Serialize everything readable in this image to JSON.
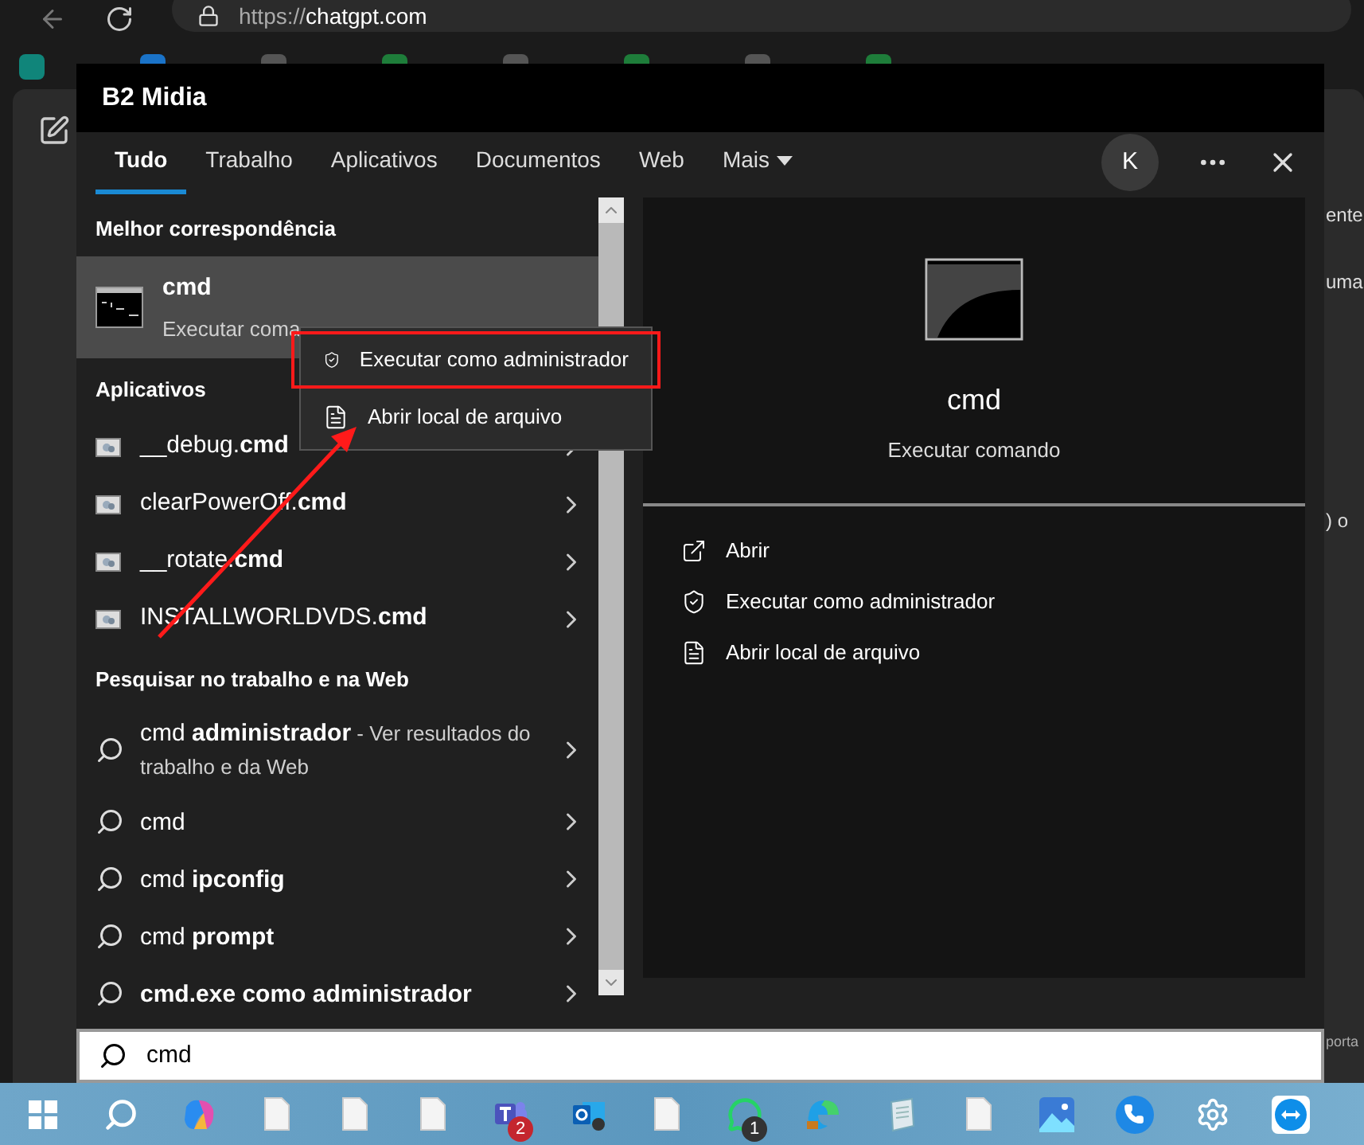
{
  "browser": {
    "url_scheme": "https://",
    "url_host": "chatgpt.com"
  },
  "background_fragments": [
    "ente",
    "uma",
    ") o",
    "porta"
  ],
  "window": {
    "title": "B2 Midia"
  },
  "tabs": [
    {
      "label": "Tudo",
      "selected": true,
      "kind": "tab"
    },
    {
      "label": "Trabalho",
      "selected": false,
      "kind": "tab"
    },
    {
      "label": "Aplicativos",
      "selected": false,
      "kind": "tab"
    },
    {
      "label": "Documentos",
      "selected": false,
      "kind": "tab"
    },
    {
      "label": "Web",
      "selected": false,
      "kind": "tab"
    },
    {
      "label": "Mais",
      "selected": false,
      "kind": "dropdown"
    }
  ],
  "account": {
    "initial": "K"
  },
  "sections": [
    {
      "heading": "Melhor correspondência",
      "items": [
        {
          "kind": "best",
          "title": "cmd",
          "subtitle": "Executar coma",
          "selected": true
        }
      ]
    },
    {
      "heading": "Aplicativos",
      "items": [
        {
          "kind": "app",
          "title": "__debug.**cmd**",
          "selected": false
        },
        {
          "kind": "app",
          "title": "clearPowerOff.**cmd**",
          "selected": false
        },
        {
          "kind": "app",
          "title": "__rotate.**cmd**",
          "selected": false
        },
        {
          "kind": "app",
          "title": "INSTALLWORLDVDS.**cmd**",
          "selected": false
        }
      ]
    },
    {
      "heading": "Pesquisar no trabalho e na Web",
      "items": [
        {
          "kind": "web",
          "title": "cmd **administrador**",
          "suffix": " - Ver resultados do trabalho e da Web",
          "bold": false,
          "selected": false
        },
        {
          "kind": "web",
          "title": "cmd",
          "bold": false,
          "selected": false
        },
        {
          "kind": "web",
          "title": "cmd **ipconfig**",
          "bold": false,
          "selected": false
        },
        {
          "kind": "web",
          "title": "cmd **prompt**",
          "bold": false,
          "selected": false
        },
        {
          "kind": "web",
          "title": "cmd.exe como administrador",
          "bold": true,
          "selected": false
        }
      ]
    }
  ],
  "context_menu": [
    {
      "label": "Executar como administrador",
      "kind": "admin",
      "highlighted": true
    },
    {
      "label": "Abrir local de arquivo",
      "kind": "location",
      "highlighted": false
    }
  ],
  "preview": {
    "title": "cmd",
    "subtitle": "Executar comando",
    "actions": [
      {
        "label": "Abrir",
        "kind": "open"
      },
      {
        "label": "Executar como administrador",
        "kind": "admin"
      },
      {
        "label": "Abrir local de arquivo",
        "kind": "location"
      }
    ]
  },
  "search": {
    "value": "cmd"
  },
  "taskbar": [
    {
      "kind": "start"
    },
    {
      "kind": "search"
    },
    {
      "kind": "copilot"
    },
    {
      "kind": "file"
    },
    {
      "kind": "file"
    },
    {
      "kind": "file"
    },
    {
      "kind": "teams",
      "badge": "2"
    },
    {
      "kind": "outlook"
    },
    {
      "kind": "file"
    },
    {
      "kind": "whatsapp",
      "badge": "1"
    },
    {
      "kind": "edge"
    },
    {
      "kind": "notepad"
    },
    {
      "kind": "file"
    },
    {
      "kind": "photos"
    },
    {
      "kind": "phone"
    },
    {
      "kind": "settings"
    },
    {
      "kind": "remote"
    }
  ]
}
